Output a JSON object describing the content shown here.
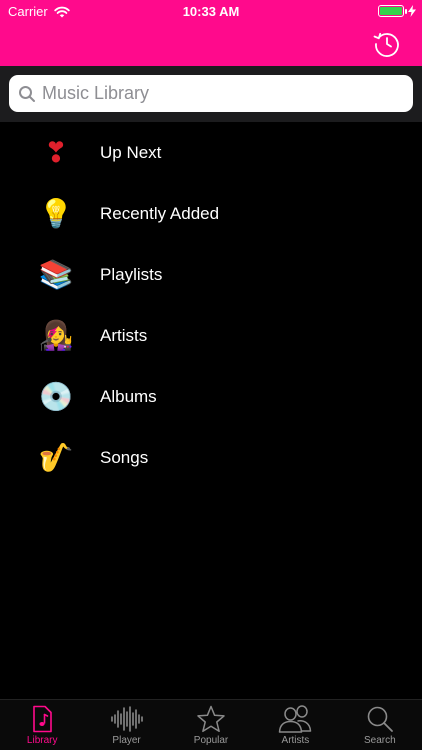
{
  "status_bar": {
    "carrier": "Carrier",
    "time": "10:33 AM"
  },
  "colors": {
    "accent": "#ff0a8c",
    "background": "#000000",
    "battery": "#35d14c"
  },
  "header": {
    "history_icon": "history-clock-icon"
  },
  "search": {
    "placeholder": "Music Library"
  },
  "library_items": [
    {
      "label": "Up Next",
      "icon": "heart-exclamation-icon",
      "glyph": "❣"
    },
    {
      "label": "Recently Added",
      "icon": "lightbulb-icon",
      "glyph": "💡"
    },
    {
      "label": "Playlists",
      "icon": "books-icon",
      "glyph": "📚"
    },
    {
      "label": "Artists",
      "icon": "singer-icon",
      "glyph": "👩‍🎤"
    },
    {
      "label": "Albums",
      "icon": "disc-icon",
      "glyph": "💿"
    },
    {
      "label": "Songs",
      "icon": "saxophone-icon",
      "glyph": "🎷"
    }
  ],
  "tabs": [
    {
      "label": "Library",
      "icon": "music-note-icon",
      "active": true
    },
    {
      "label": "Player",
      "icon": "waveform-icon",
      "active": false
    },
    {
      "label": "Popular",
      "icon": "star-icon",
      "active": false
    },
    {
      "label": "Artists",
      "icon": "people-icon",
      "active": false
    },
    {
      "label": "Search",
      "icon": "search-icon",
      "active": false
    }
  ]
}
